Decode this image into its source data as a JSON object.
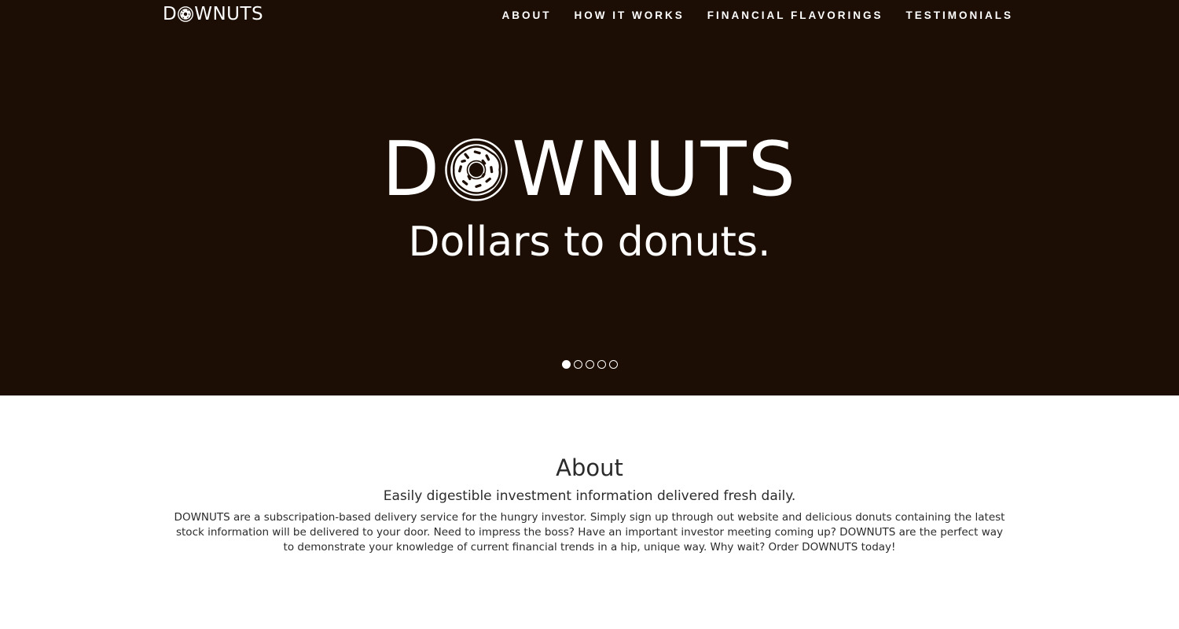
{
  "nav": {
    "logo_prefix": "D",
    "logo_suffix": "WNUTS",
    "links": [
      "ABOUT",
      "HOW IT WORKS",
      "FINANCIAL FLAVORINGS",
      "TESTIMONIALS"
    ]
  },
  "hero": {
    "brand_prefix": "D",
    "brand_suffix": "WNUTS",
    "tagline": "Dollars to donuts.",
    "slides_total": 5,
    "active_slide": 1,
    "background_color": "#1c0e04"
  },
  "about": {
    "title": "About",
    "subtitle": "Easily digestible investment information delivered fresh daily.",
    "body": "DOWNUTS are a subscripation-based delivery service for the hungry investor. Simply sign up through out website and delicious donuts containing the latest stock information will be delivered to your door. Need to impress the boss? Have an important investor meeting coming up? DOWNUTS are the perfect way to demonstrate your knowledge of current financial trends in a hip, unique way. Why wait? Order DOWNUTS today!"
  }
}
